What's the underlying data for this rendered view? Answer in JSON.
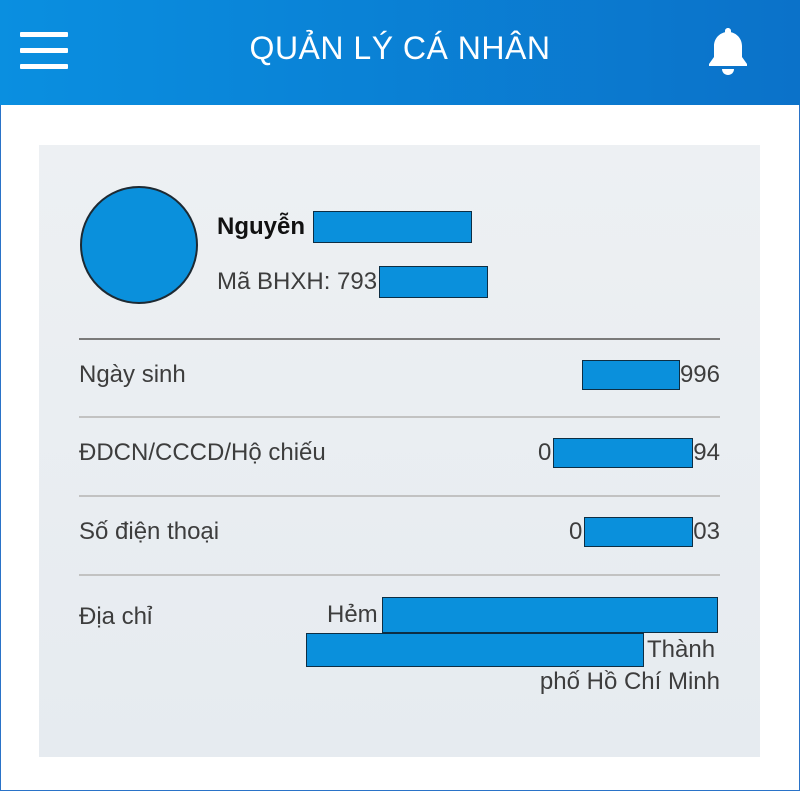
{
  "header": {
    "title": "QUẢN LÝ CÁ NHÂN",
    "menu_icon": "hamburger-menu-icon",
    "bell_icon": "bell-icon",
    "bg_color": "#0a8fe0"
  },
  "profile": {
    "name_prefix": "Nguyễn",
    "id_label": "Mã BHXH: 793",
    "redaction_color": "#0a90dc"
  },
  "fields": [
    {
      "label": "Ngày sinh",
      "value_prefix": "",
      "value_suffix": "996"
    },
    {
      "label": "ĐDCN/CCCD/Hộ chiếu",
      "value_prefix": "0",
      "value_suffix": "94"
    },
    {
      "label": "Số điện thoại",
      "value_prefix": "0",
      "value_suffix": "03"
    }
  ],
  "address": {
    "label": "Địa chỉ",
    "line1_prefix": "Hẻm",
    "line2_suffix": "Thành",
    "line3": "phố Hồ Chí Minh"
  }
}
